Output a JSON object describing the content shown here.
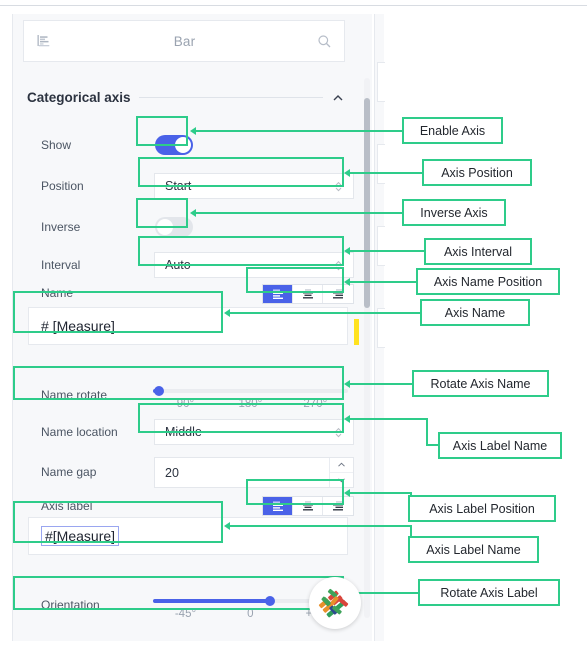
{
  "panel": {
    "chart_type_header": {
      "icon": "bar-chart-icon",
      "title": "Bar",
      "search_icon": "search-icon",
      "placeholder": "Bar"
    },
    "section": {
      "title": "Categorical axis",
      "collapse_icon": "chevron-up-icon"
    },
    "rows": [
      {
        "label": "Show",
        "control": "toggle",
        "value": "on"
      },
      {
        "label": "Position",
        "control": "select",
        "value": "Start"
      },
      {
        "label": "Inverse",
        "control": "toggle",
        "value": "off"
      },
      {
        "label": "Interval",
        "control": "select",
        "value": "Auto"
      },
      {
        "label": "Name",
        "control": "align-group",
        "value": "left"
      },
      {
        "label": "Name rotate",
        "control": "slider",
        "value": "0"
      },
      {
        "label": "Name location",
        "control": "select",
        "value": "Middle"
      },
      {
        "label": "Name gap",
        "control": "stepper",
        "value": "20"
      },
      {
        "label": "Axis label",
        "control": "align-group",
        "value": "left"
      },
      {
        "label": "Orientation",
        "control": "slider",
        "value": "0"
      }
    ],
    "name_input": {
      "value": "# [Measure]"
    },
    "axis_label_input": {
      "token": "#[Measure]"
    },
    "name_rotate_slider": {
      "ticks": [
        "90°",
        "180°",
        "270°"
      ],
      "fill_percent": 3
    },
    "orientation_slider": {
      "ticks": [
        "-45°",
        "0",
        "+45"
      ],
      "fill_percent": 60
    },
    "align_buttons": [
      {
        "icon": "align-left-icon",
        "state": "active"
      },
      {
        "icon": "align-center-icon",
        "state": "inactive"
      },
      {
        "icon": "align-right-icon",
        "state": "inactive"
      }
    ]
  },
  "annotations": [
    {
      "label": "Enable Axis"
    },
    {
      "label": "Axis Position"
    },
    {
      "label": "Inverse Axis"
    },
    {
      "label": "Axis Interval"
    },
    {
      "label": "Axis Name Position"
    },
    {
      "label": "Axis Name"
    },
    {
      "label": "Rotate Axis Name"
    },
    {
      "label": "Axis Label Name"
    },
    {
      "label": "Axis Label Position"
    },
    {
      "label": "Axis Label Name"
    },
    {
      "label": "Rotate Axis Label"
    }
  ],
  "colors": {
    "accent_blue": "#4a62e8",
    "annotation_green": "#2ecc8a",
    "panel_bg": "#f7f8fa",
    "marker_yellow": "#ffe21f",
    "text_dark": "#2c3340",
    "text_muted": "#9aa3b0"
  },
  "logo": {
    "name": "app-logo"
  }
}
